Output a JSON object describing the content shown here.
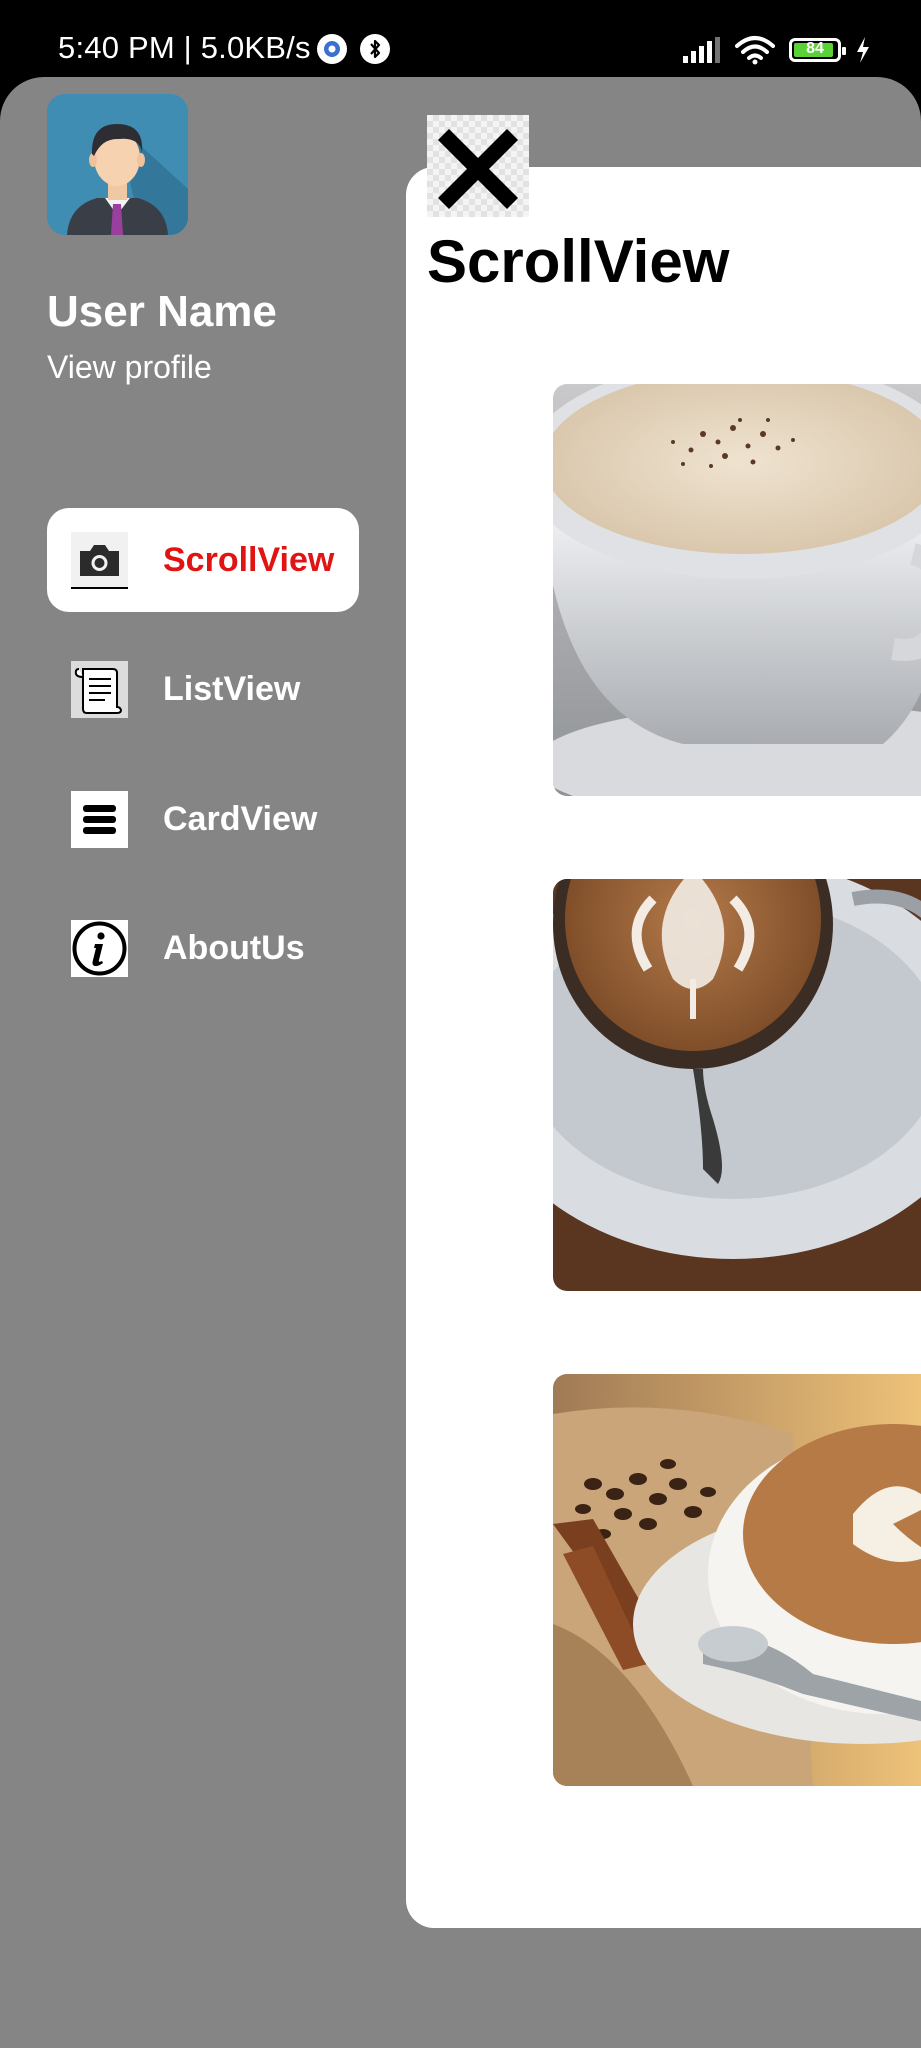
{
  "status_bar": {
    "time_speed": "5:40 PM | 5.0KB/s",
    "battery_level": "84",
    "icons": [
      "settings-icon",
      "bluetooth-icon",
      "signal-icon",
      "wifi-icon",
      "battery-icon",
      "charging-icon"
    ]
  },
  "drawer": {
    "user_name": "User Name",
    "view_profile": "View profile",
    "menu": [
      {
        "label": "ScrollView",
        "icon": "camera-icon",
        "active": true
      },
      {
        "label": "ListView",
        "icon": "scroll-icon",
        "active": false
      },
      {
        "label": "CardView",
        "icon": "menu-icon",
        "active": false
      },
      {
        "label": "AboutUs",
        "icon": "info-icon",
        "active": false
      }
    ]
  },
  "content": {
    "title": "ScrollView",
    "close_icon": "close-icon",
    "images": [
      "cappuccino-cup-photo",
      "latte-art-photo",
      "coffee-beans-latte-photo"
    ]
  },
  "colors": {
    "drawer_bg": "#858585",
    "active_label": "#e11414",
    "battery_fill": "#5bd138"
  }
}
